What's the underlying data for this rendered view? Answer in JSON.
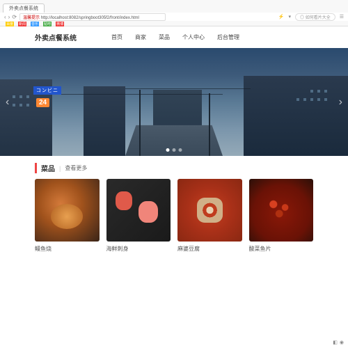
{
  "browser": {
    "tab_title": "外卖点餐系统",
    "url_prefix": "温馨提示",
    "url": "http://localhost:8082/springboot305f2/front/index.html",
    "search_placeholder": "如何看片大全",
    "bookmarks": [
      "百度",
      "新闻",
      "音乐",
      "贴吧",
      "微博"
    ]
  },
  "nav": {
    "brand": "外卖点餐系统",
    "links": [
      "首页",
      "商家",
      "菜品",
      "个人中心",
      "后台管理"
    ]
  },
  "banner": {
    "sign_24": "24",
    "sign_jp": "コンビニ"
  },
  "section": {
    "title": "菜品",
    "more": "查看更多"
  },
  "cards": [
    {
      "label": "鳗鱼烧"
    },
    {
      "label": "海鲜刺身"
    },
    {
      "label": "麻婆豆腐"
    },
    {
      "label": "酸菜鱼片"
    }
  ]
}
